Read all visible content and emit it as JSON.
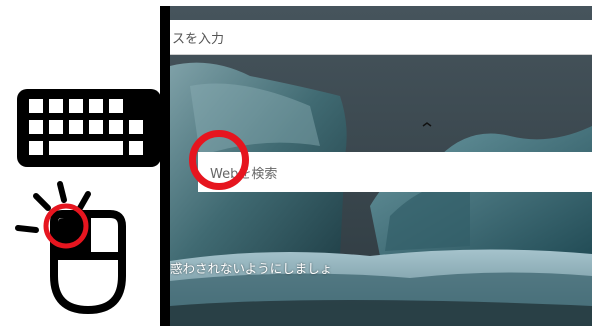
{
  "browser": {
    "address_bar_placeholder": "スを入力",
    "search_placeholder": "Webを検索",
    "caption": "惑わされないようにしましょ"
  },
  "illustration": {
    "icons": [
      "keyboard-icon",
      "mouse-icon"
    ],
    "click_indicator": "left-click"
  },
  "colors": {
    "highlight": "#e6151f",
    "icon": "#000000"
  }
}
